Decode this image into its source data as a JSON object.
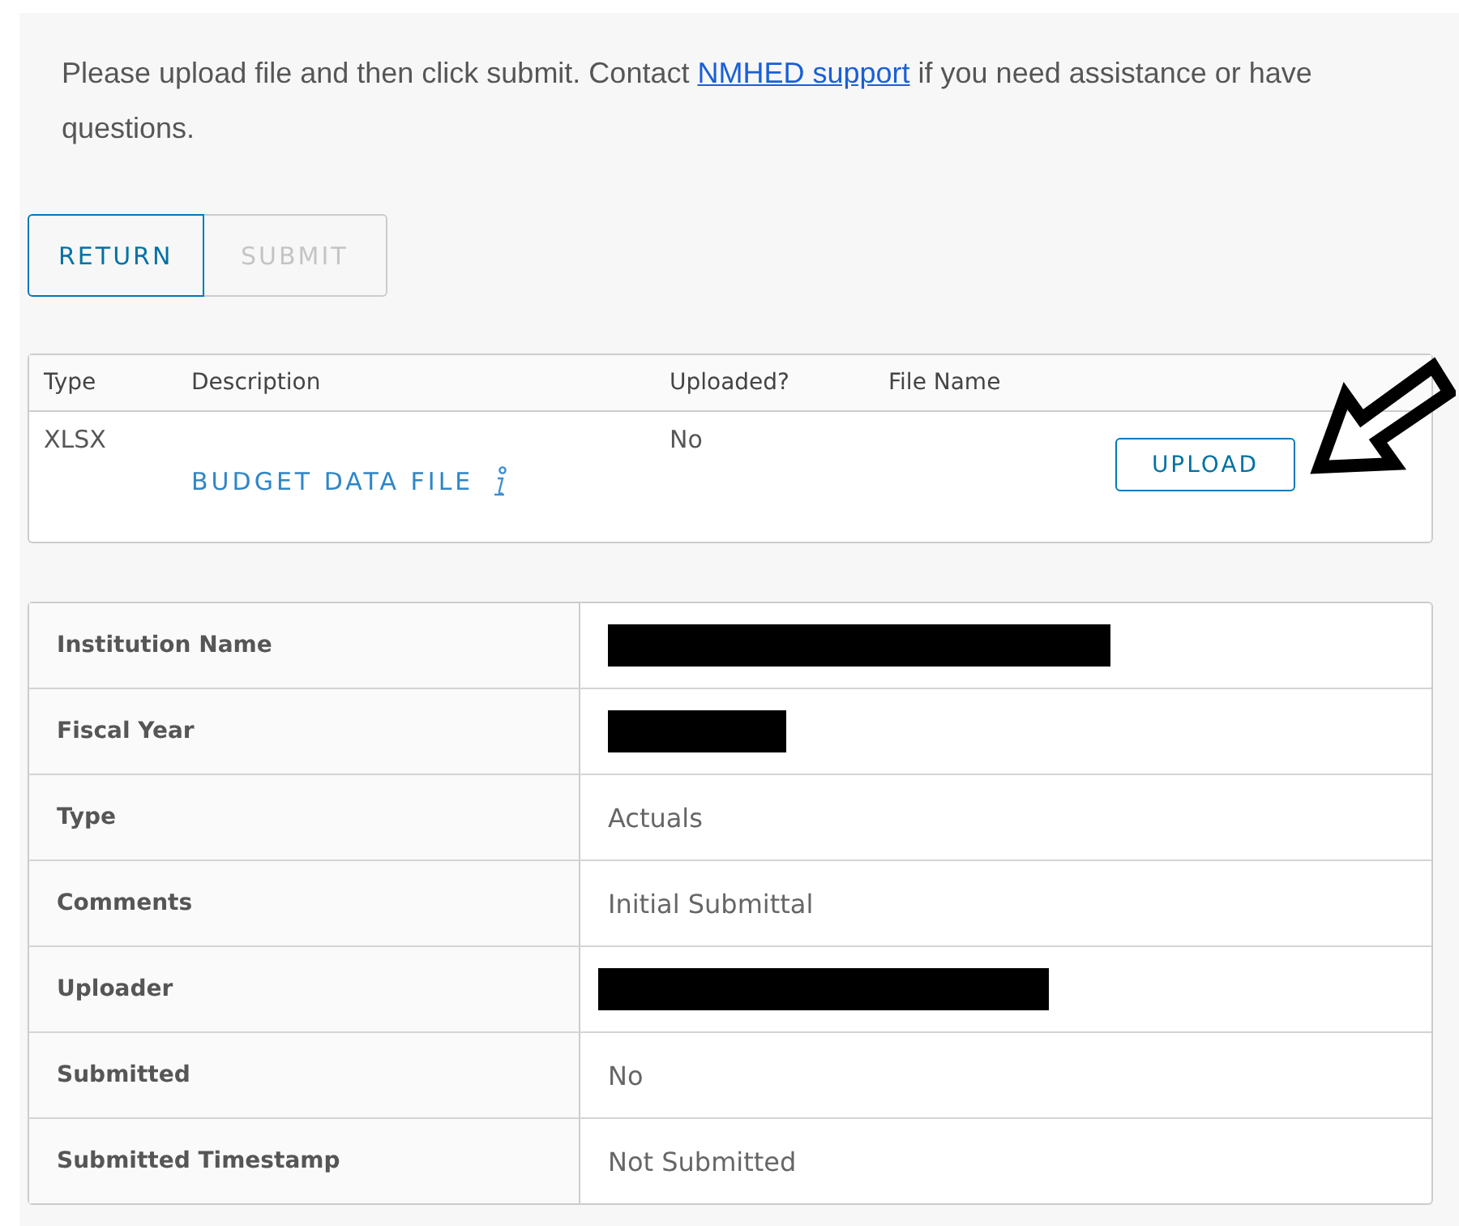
{
  "intro": {
    "before": "Please upload file and then click submit. Contact ",
    "link": "NMHED support",
    "after": " if you need assistance or have questions."
  },
  "buttons": [
    {
      "label": "RETURN",
      "disabled": false
    },
    {
      "label": "SUBMIT",
      "disabled": true
    }
  ],
  "files": {
    "columns": [
      "Type",
      "Description",
      "Uploaded?",
      "File Name"
    ],
    "rows": [
      {
        "type": "XLSX",
        "description": "BUDGET DATA FILE",
        "uploaded": "No",
        "action": "UPLOAD"
      }
    ]
  },
  "details": [
    {
      "label": "Institution Name",
      "kind": "redacted"
    },
    {
      "label": "Fiscal Year",
      "kind": "redacted"
    },
    {
      "label": "Type",
      "kind": "text",
      "value": "Actuals"
    },
    {
      "label": "Comments",
      "kind": "text",
      "value": "Initial Submittal"
    },
    {
      "label": "Uploader",
      "kind": "redacted"
    },
    {
      "label": "Submitted",
      "kind": "text",
      "value": "No"
    },
    {
      "label": "Submitted Timestamp",
      "kind": "text",
      "value": "Not Submitted"
    }
  ]
}
